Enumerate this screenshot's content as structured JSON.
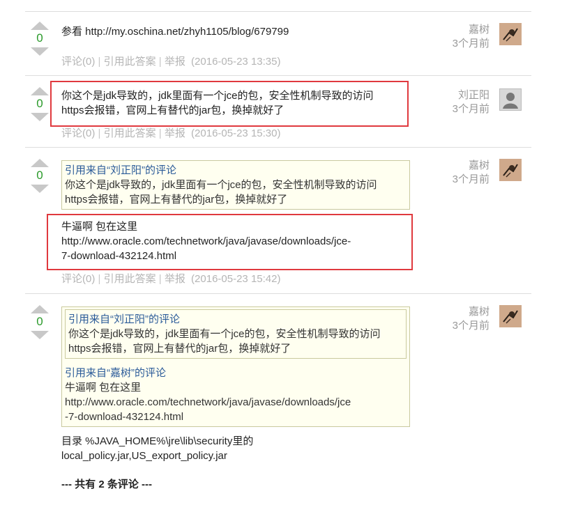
{
  "answers": [
    {
      "vote": "0",
      "content": "参看 http://my.oschina.net/zhyh1105/blog/679799",
      "user": "嘉树",
      "time_ago": "3个月前",
      "avatar": "sketch-avatar",
      "meta": {
        "comment": "评论(0)",
        "quote": "引用此答案",
        "report": "举报",
        "date": "(2016-05-23 13:35)"
      }
    },
    {
      "vote": "0",
      "content_line1": "你这个是jdk导致的，jdk里面有一个jce的包，安全性机制导致的访问",
      "content_line2": "https会报错，官网上有替代的jar包，换掉就好了",
      "user": "刘正阳",
      "time_ago": "3个月前",
      "avatar": "default-avatar",
      "meta": {
        "comment": "评论(0)",
        "quote": "引用此答案",
        "report": "举报",
        "date": "(2016-05-23 15:30)"
      }
    },
    {
      "vote": "0",
      "quote_head": "引用来自“刘正阳”的评论",
      "quote_line1": "你这个是jdk导致的，jdk里面有一个jce的包，安全性机制导致的访问",
      "quote_line2": "https会报错，官网上有替代的jar包，换掉就好了",
      "content_line1": "牛逼啊 包在这里",
      "content_line2": "http://www.oracle.com/technetwork/java/javase/downloads/jce-",
      "content_line3": "7-download-432124.html",
      "user": "嘉树",
      "time_ago": "3个月前",
      "avatar": "sketch-avatar",
      "meta": {
        "comment": "评论(0)",
        "quote": "引用此答案",
        "report": "举报",
        "date": "(2016-05-23 15:42)"
      }
    },
    {
      "vote": "0",
      "inner_quote_head": "引用来自“刘正阳”的评论",
      "inner_quote_line1": "你这个是jdk导致的，jdk里面有一个jce的包，安全性机制导致的访问",
      "inner_quote_line2": "https会报错，官网上有替代的jar包，换掉就好了",
      "outer_quote_head": "引用来自“嘉树”的评论",
      "outer_quote_line1": "牛逼啊 包在这里",
      "outer_quote_line2": "http://www.oracle.com/technetwork/java/javase/downloads/jce",
      "outer_quote_line3": "-7-download-432124.html",
      "content_line1": "目录 %JAVA_HOME%\\jre\\lib\\security里的",
      "content_line2": "local_policy.jar,US_export_policy.jar",
      "comments_total": "--- 共有 2 条评论 ---",
      "user": "嘉树",
      "time_ago": "3个月前",
      "avatar": "sketch-avatar"
    }
  ],
  "colors": {
    "vote_count": "#2a9a2a",
    "quote_header": "#2b5b99",
    "highlight_box": "#e0393e",
    "quote_background": "#fffff0"
  }
}
